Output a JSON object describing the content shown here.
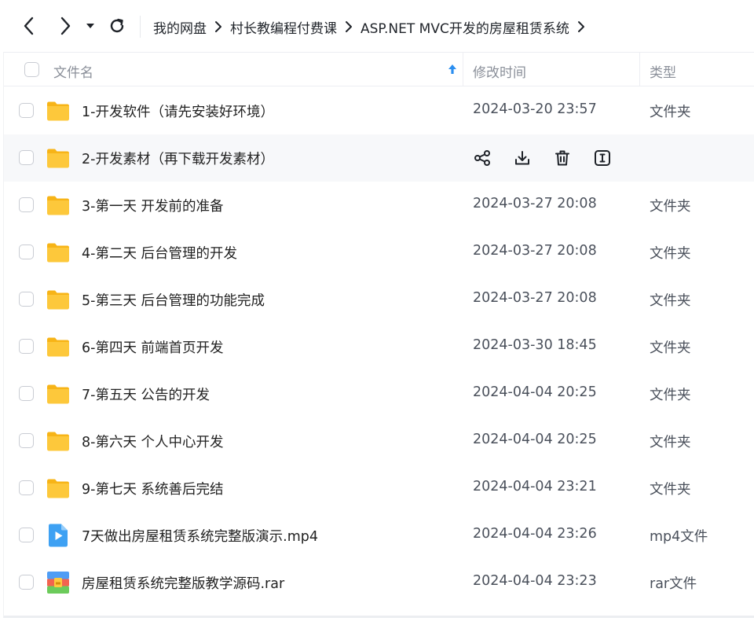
{
  "nav": {
    "back_icon": "chevron-left-icon",
    "forward_icon": "chevron-right-icon",
    "history_icon": "caret-down-icon",
    "refresh_icon": "refresh-icon"
  },
  "breadcrumb": [
    "我的网盘",
    "村长教编程付费课",
    "ASP.NET MVC开发的房屋租赁系统"
  ],
  "header": {
    "name": "文件名",
    "modified": "修改时间",
    "type": "类型",
    "sort_icon": "arrow-up-icon",
    "accent_color": "#2b8ef0"
  },
  "hover_actions": [
    "share-icon",
    "download-icon",
    "delete-icon",
    "rename-icon"
  ],
  "files": [
    {
      "name": "1-开发软件（请先安装好环境）",
      "modified": "2024-03-20 23:57",
      "type": "文件夹",
      "icon": "folder-icon"
    },
    {
      "name": "2-开发素材（再下载开发素材）",
      "modified": "",
      "type": "",
      "icon": "folder-icon",
      "hover": true
    },
    {
      "name": "3-第一天 开发前的准备",
      "modified": "2024-03-27 20:08",
      "type": "文件夹",
      "icon": "folder-icon"
    },
    {
      "name": "4-第二天 后台管理的开发",
      "modified": "2024-03-27 20:08",
      "type": "文件夹",
      "icon": "folder-icon"
    },
    {
      "name": "5-第三天 后台管理的功能完成",
      "modified": "2024-03-27 20:08",
      "type": "文件夹",
      "icon": "folder-icon"
    },
    {
      "name": "6-第四天 前端首页开发",
      "modified": "2024-03-30 18:45",
      "type": "文件夹",
      "icon": "folder-icon"
    },
    {
      "name": "7-第五天 公告的开发",
      "modified": "2024-04-04 20:25",
      "type": "文件夹",
      "icon": "folder-icon"
    },
    {
      "name": "8-第六天 个人中心开发",
      "modified": "2024-04-04 20:25",
      "type": "文件夹",
      "icon": "folder-icon"
    },
    {
      "name": "9-第七天 系统善后完结",
      "modified": "2024-04-04 23:21",
      "type": "文件夹",
      "icon": "folder-icon"
    },
    {
      "name": "7天做出房屋租赁系统完整版演示.mp4",
      "modified": "2024-04-04 23:26",
      "type": "mp4文件",
      "icon": "video-file-icon"
    },
    {
      "name": "房屋租赁系统完整版教学源码.rar",
      "modified": "2024-04-04 23:23",
      "type": "rar文件",
      "icon": "archive-file-icon"
    }
  ]
}
